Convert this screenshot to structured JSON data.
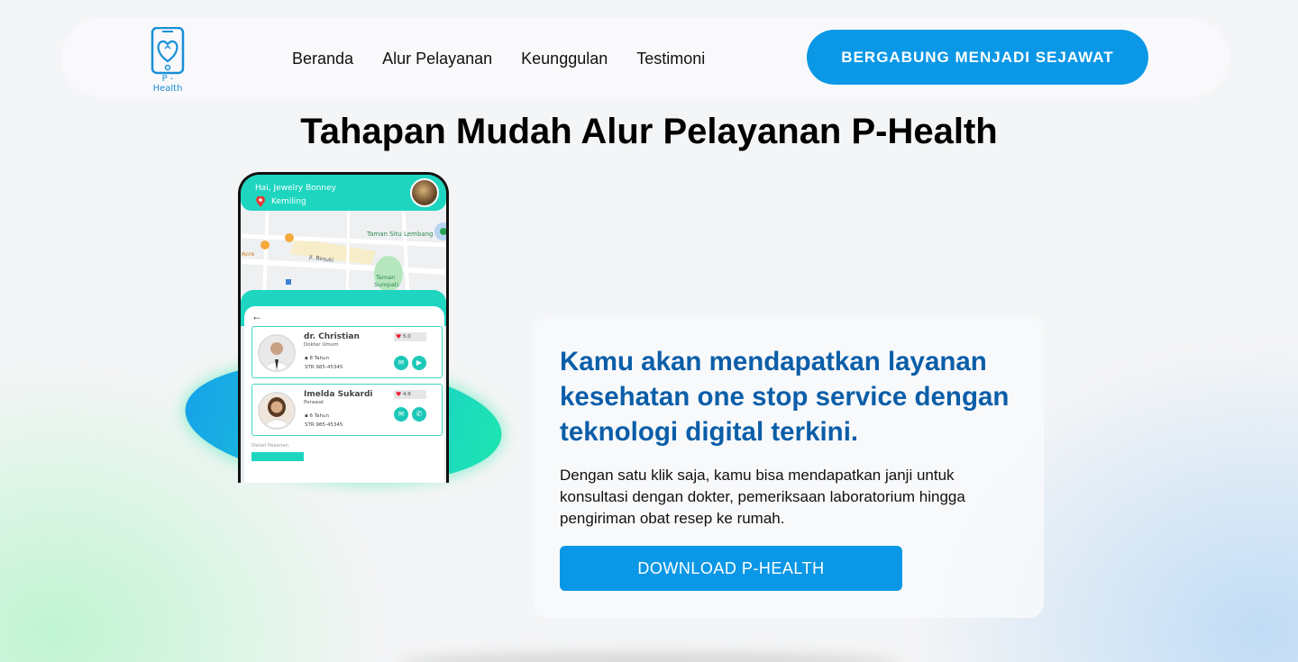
{
  "navbar": {
    "logo_text": "P - Health",
    "links": [
      "Beranda",
      "Alur Pelayanan",
      "Keunggulan",
      "Testimoni"
    ],
    "join_label": "BERGABUNG MENJADI SEJAWAT"
  },
  "main": {
    "title": "Tahapan Mudah Alur Pelayanan P-Health",
    "info": {
      "headline": "Kamu akan mendapatkan layanan kesehatan one stop service dengan teknologi digital terkini.",
      "description": "Dengan satu klik saja, kamu bisa mendapatkan janji untuk konsultasi dengan dokter, pemeriksaan laboratorium hingga pengiriman obat resep ke rumah.",
      "download_label": "DOWNLOAD P-HEALTH"
    }
  },
  "phone": {
    "greeting": "Hai, Jewelry Bonney",
    "location": "Kemiling",
    "map_labels": {
      "park1": "Taman Situ Lembang",
      "street": "Jl. Besuki",
      "park2a": "Taman",
      "park2b": "Suropati",
      "acre": "Acre"
    },
    "doctors": [
      {
        "name": "dr. Christian",
        "role": "Dokter Umum",
        "experience": "8 Tahun",
        "str": "STR 985-45345",
        "rating": "5.0"
      },
      {
        "name": "Imelda Sukardi",
        "role": "Perawat",
        "experience": "6 Tahun",
        "str": "STR 985-45345",
        "rating": "4.9"
      }
    ],
    "detail_label": "Detail Pesanan"
  },
  "colors": {
    "brand_blue": "#0a97e6",
    "headline_blue": "#0b5ea8",
    "teal": "#1ed6c0"
  }
}
